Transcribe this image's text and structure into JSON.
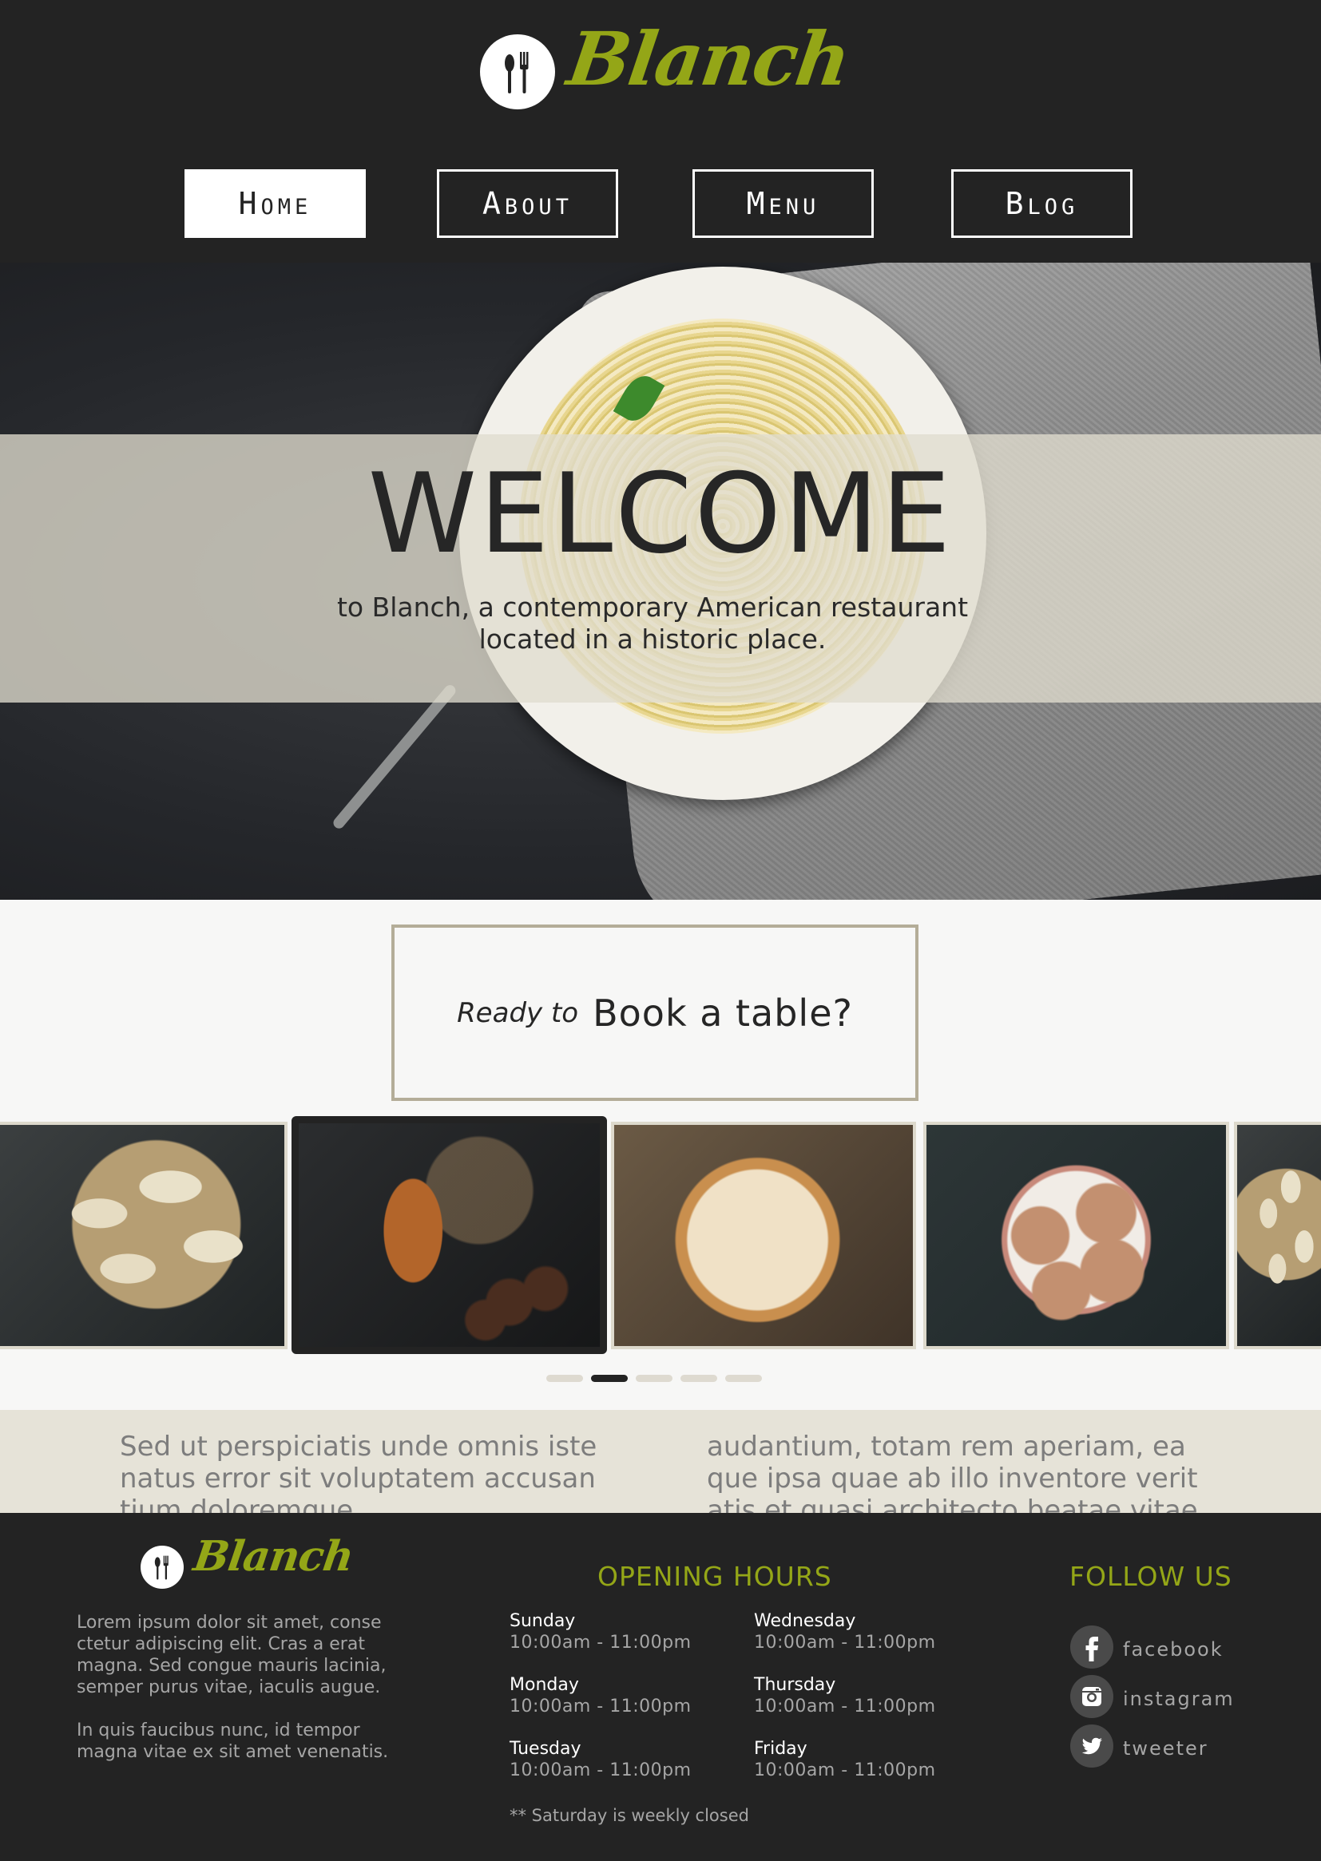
{
  "brand": {
    "name": "Blanch",
    "accent_color": "#94a617",
    "dark_color": "#232323"
  },
  "nav": {
    "items": [
      "Home",
      "About",
      "Menu",
      "Blog"
    ],
    "active": "Home"
  },
  "hero": {
    "title": "WELCOME",
    "subtitle": "to Blanch, a contemporary American restaurant located in a historic place."
  },
  "booking": {
    "lead": "Ready to",
    "cta": "Book a table?"
  },
  "carousel": {
    "slides": [
      "dumplings-photo",
      "croissant-photo",
      "berry-pie-photo",
      "cookies-photo",
      "dumplings-photo"
    ],
    "active_slide_index": 1,
    "dots_count": 5,
    "active_dot_index": 1
  },
  "intro_text": {
    "left": "Sed ut perspiciatis unde omnis iste natus error sit voluptatem accusan tium doloremque",
    "right": "audantium, totam rem aperiam, ea que ipsa quae ab illo inventore verit atis et quasi architecto beatae vitae"
  },
  "footer": {
    "about": [
      "Lorem ipsum dolor sit amet, conse ctetur adipiscing elit. Cras a erat magna. Sed congue mauris lacinia, semper purus vitae, iaculis augue.",
      "In quis faucibus nunc, id tempor magna vitae ex sit amet venenatis."
    ],
    "hours_heading": "OPENING HOURS",
    "hours": [
      {
        "day": "Sunday",
        "time": "10:00am - 11:00pm"
      },
      {
        "day": "Wednesday",
        "time": "10:00am - 11:00pm"
      },
      {
        "day": "Monday",
        "time": "10:00am - 11:00pm"
      },
      {
        "day": "Thursday",
        "time": "10:00am - 11:00pm"
      },
      {
        "day": "Tuesday",
        "time": "10:00am - 11:00pm"
      },
      {
        "day": "Friday",
        "time": "10:00am - 11:00pm"
      }
    ],
    "hours_note": "** Saturday is weekly closed",
    "follow_heading": "FOLLOW US",
    "social": [
      {
        "label": "facebook",
        "icon": "facebook-icon"
      },
      {
        "label": "instagram",
        "icon": "instagram-icon"
      },
      {
        "label": "tweeter",
        "icon": "twitter-icon"
      }
    ]
  }
}
